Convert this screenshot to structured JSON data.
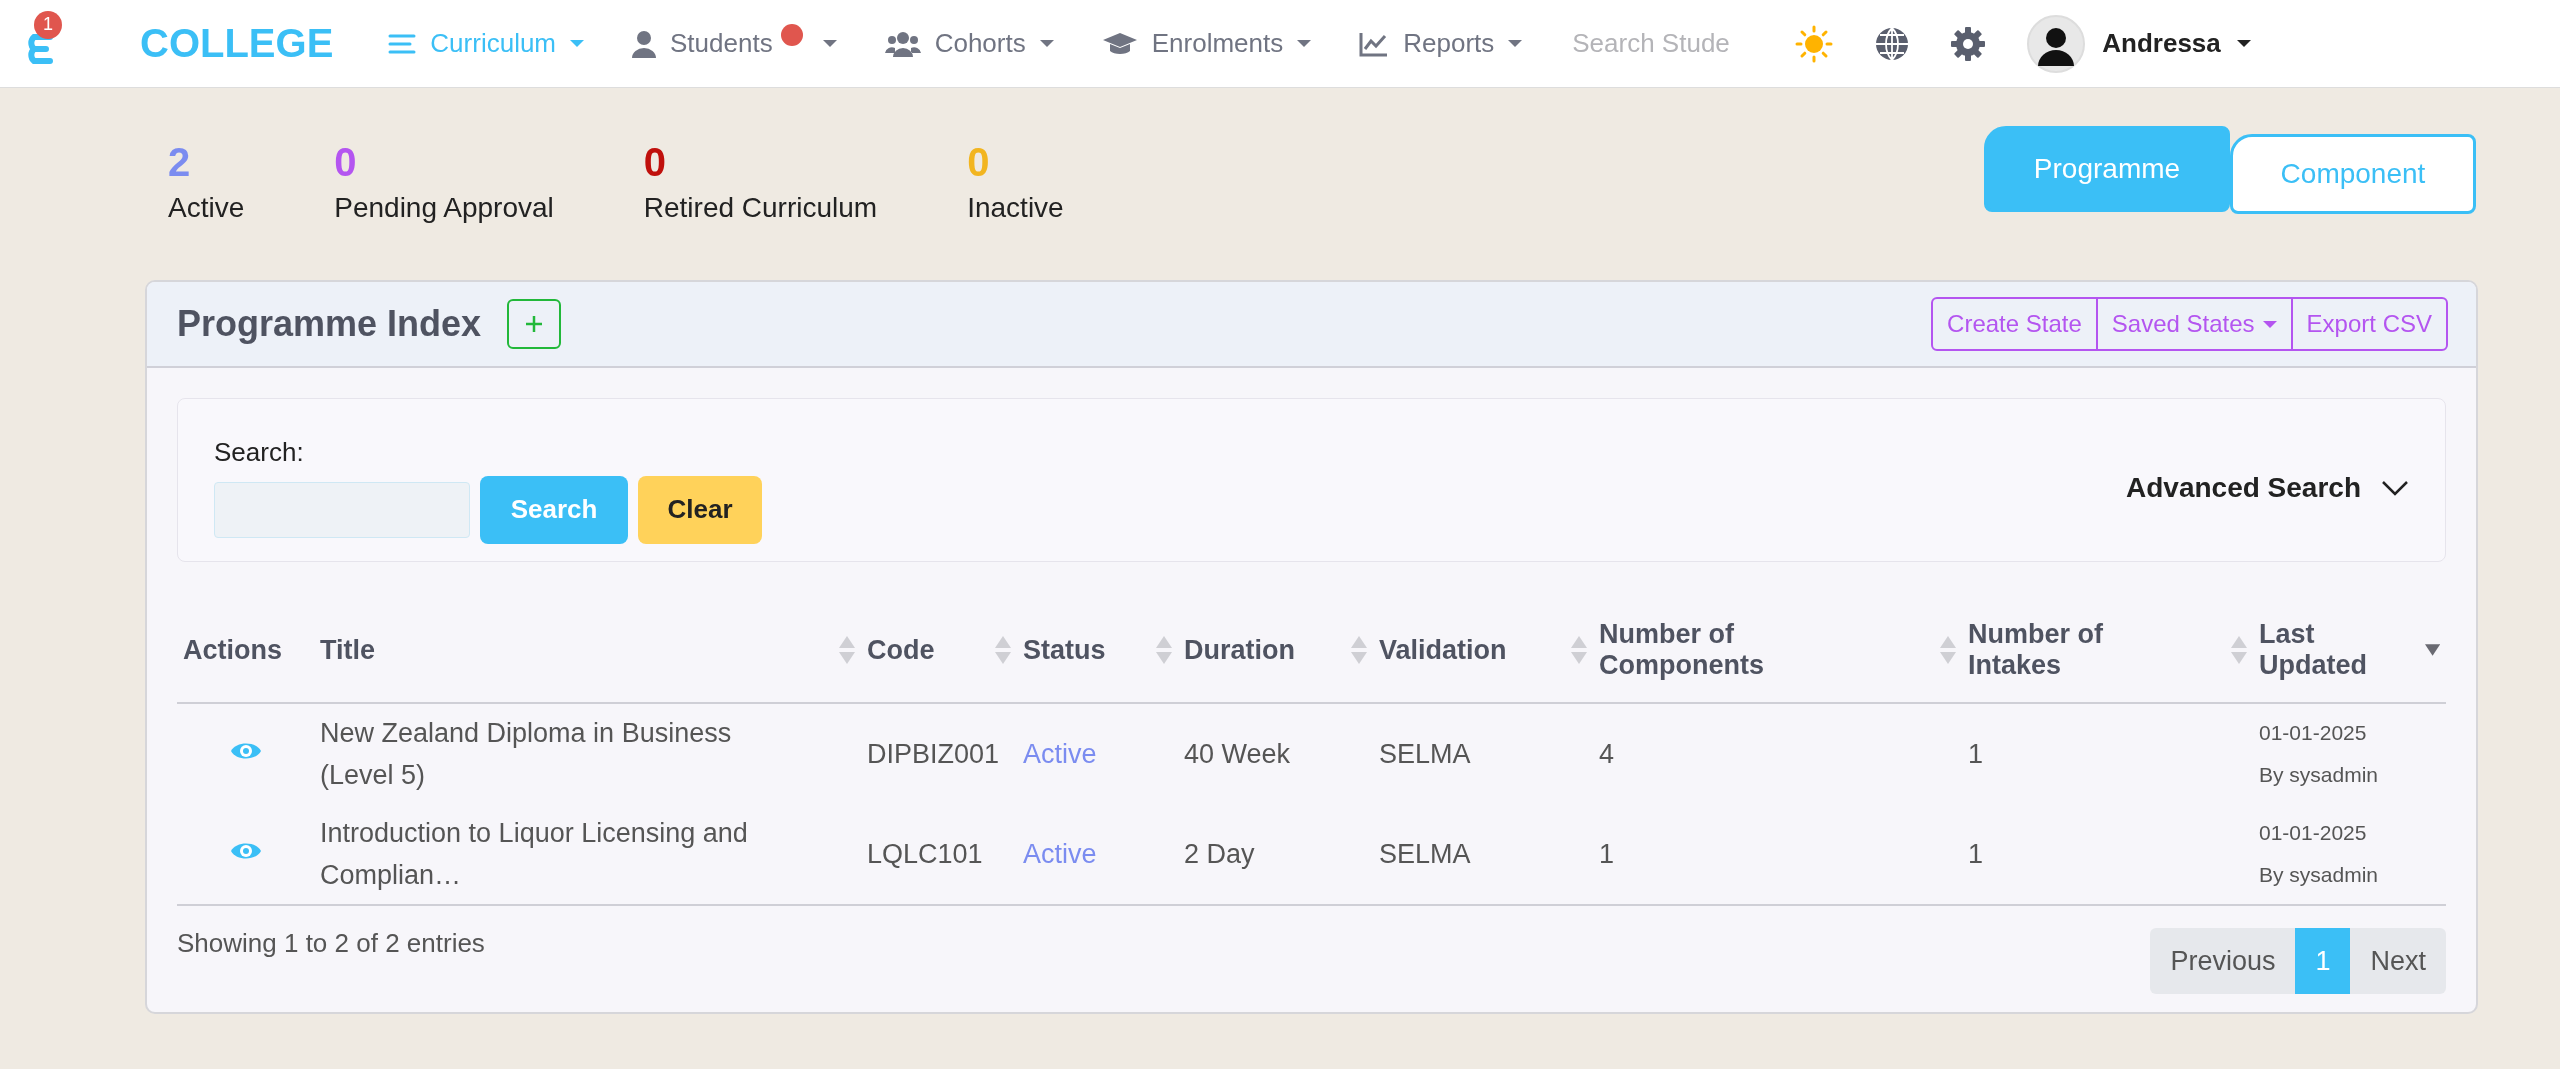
{
  "navbar": {
    "logo_badge": "1",
    "brand": "COLLEGE",
    "items": [
      {
        "label": "Curriculum",
        "selected": true,
        "alert": false
      },
      {
        "label": "Students",
        "selected": false,
        "alert": true
      },
      {
        "label": "Cohorts",
        "selected": false,
        "alert": false
      },
      {
        "label": "Enrolments",
        "selected": false,
        "alert": false
      },
      {
        "label": "Reports",
        "selected": false,
        "alert": false
      }
    ],
    "search": {
      "placeholder": "Search Stude"
    },
    "user": "Andressa"
  },
  "stats": [
    {
      "value": "2",
      "label": "Active",
      "color": "#7b8cf0"
    },
    {
      "value": "0",
      "label": "Pending Approval",
      "color": "#b455f0"
    },
    {
      "value": "0",
      "label": "Retired Curriculum",
      "color": "#c0100c"
    },
    {
      "value": "0",
      "label": "Inactive",
      "color": "#f2b51f"
    }
  ],
  "tabs": [
    {
      "label": "Programme",
      "selected": true
    },
    {
      "label": "Component",
      "selected": false
    }
  ],
  "card": {
    "title": "Programme Index",
    "actions": [
      {
        "label": "Create State",
        "dropdown": false
      },
      {
        "label": "Saved States",
        "dropdown": true
      },
      {
        "label": "Export CSV",
        "dropdown": false
      }
    ]
  },
  "search_panel": {
    "label": "Search:",
    "buttons": [
      {
        "label": "Search",
        "kind": "primary"
      },
      {
        "label": "Clear",
        "kind": "warning"
      }
    ],
    "advanced": "Advanced Search"
  },
  "table": {
    "columns": [
      {
        "label": "Actions",
        "sortable": false
      },
      {
        "label": "Title",
        "sortable": true,
        "sorted_desc": false
      },
      {
        "label": "Code",
        "sortable": true,
        "sorted_desc": false
      },
      {
        "label": "Status",
        "sortable": true,
        "sorted_desc": false
      },
      {
        "label": "Duration",
        "sortable": true,
        "sorted_desc": false
      },
      {
        "label": "Validation",
        "sortable": true,
        "sorted_desc": false
      },
      {
        "label": "Number of Components",
        "sortable": true,
        "sorted_desc": false
      },
      {
        "label": "Number of Intakes",
        "sortable": true,
        "sorted_desc": false
      },
      {
        "label": "Last Updated",
        "sortable": true,
        "sorted_desc": true
      }
    ],
    "rows": [
      {
        "title": "New Zealand Diploma in Business (Level 5)",
        "code": "DIPBIZ001",
        "status": "Active",
        "duration": "40 Week",
        "validation": "SELMA",
        "components": "4",
        "intakes": "1",
        "updated": "01-01-2025",
        "by": "By sysadmin"
      },
      {
        "title": "Introduction to Liquor Licensing and Complian…",
        "code": "LQLC101",
        "status": "Active",
        "duration": "2 Day",
        "validation": "SELMA",
        "components": "1",
        "intakes": "1",
        "updated": "01-01-2025",
        "by": "By sysadmin"
      }
    ]
  },
  "footer": {
    "info": "Showing 1 to 2 of 2 entries",
    "pagination": [
      {
        "label": "Previous",
        "selected": false
      },
      {
        "label": "1",
        "selected": true
      },
      {
        "label": "Next",
        "selected": false
      }
    ]
  }
}
